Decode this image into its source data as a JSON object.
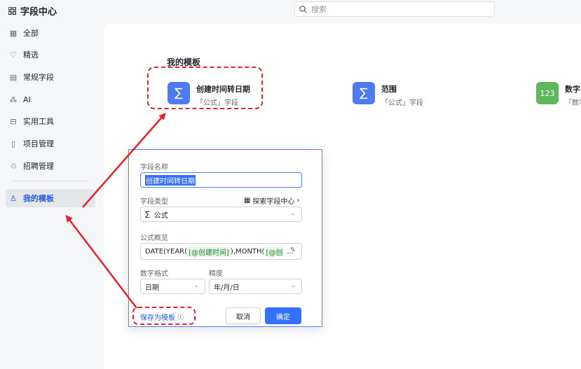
{
  "app": {
    "title": "字段中心"
  },
  "search": {
    "placeholder": "搜索"
  },
  "sidebar": {
    "items": [
      {
        "label": "全部",
        "icon": "grid-icon"
      },
      {
        "label": "精选",
        "icon": "heart-icon"
      },
      {
        "label": "常规字段",
        "icon": "form-icon"
      },
      {
        "label": "AI",
        "icon": "ai-icon"
      },
      {
        "label": "实用工具",
        "icon": "toolbox-icon"
      },
      {
        "label": "项目管理",
        "icon": "project-icon"
      },
      {
        "label": "招聘管理",
        "icon": "recruit-icon"
      },
      {
        "label": "我的模板",
        "icon": "user-icon",
        "active": true
      }
    ]
  },
  "main": {
    "section_title": "我的模板",
    "cards": [
      {
        "name": "创建时间转日期",
        "sub": "「公式」字段",
        "badge": "∑",
        "color": "#4e7cf0"
      },
      {
        "name": "范围",
        "sub": "「公式」字段",
        "badge": "∑",
        "color": "#4e7cf0"
      },
      {
        "name": "数字",
        "sub": "「数字",
        "badge": "123",
        "color": "#5fb75b"
      }
    ]
  },
  "dialog": {
    "field_name_label": "字段名称",
    "field_name_value": "创建时间转日期",
    "field_type_label": "字段类型",
    "explore_link": "探索字段中心",
    "field_type_value": "公式",
    "formula_label": "公式概览",
    "formula": {
      "prefix": "DATE(YEAR(",
      "tag1": "[@创建时间]",
      "mid": "),MONTH(",
      "tag2": "[@创",
      "suffix": "..."
    },
    "number_format_label": "数字格式",
    "number_format_value": "日期",
    "precision_label": "精度",
    "precision_value": "年/月/日",
    "save_template": "保存为模板",
    "cancel": "取消",
    "confirm": "确定"
  },
  "colors": {
    "accent": "#3370ff",
    "annotation": "#e8202a"
  }
}
